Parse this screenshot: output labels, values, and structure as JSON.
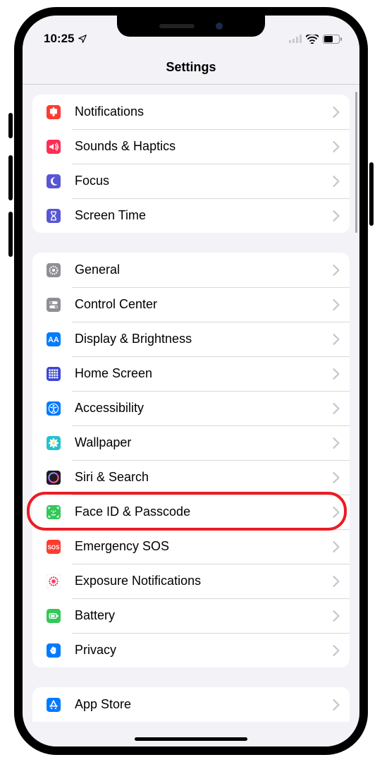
{
  "status": {
    "time": "10:25"
  },
  "header": {
    "title": "Settings"
  },
  "groups": [
    {
      "id": "g1",
      "items": [
        {
          "id": "notifications",
          "label": "Notifications",
          "icon": "bell-icon",
          "color": "#ff3b30"
        },
        {
          "id": "sounds-haptics",
          "label": "Sounds & Haptics",
          "icon": "speaker-icon",
          "color": "#ff2d55"
        },
        {
          "id": "focus",
          "label": "Focus",
          "icon": "moon-icon",
          "color": "#5856d6"
        },
        {
          "id": "screen-time",
          "label": "Screen Time",
          "icon": "hourglass-icon",
          "color": "#5856d6"
        }
      ]
    },
    {
      "id": "g2",
      "items": [
        {
          "id": "general",
          "label": "General",
          "icon": "gear-icon",
          "color": "#8e8e93"
        },
        {
          "id": "control-center",
          "label": "Control Center",
          "icon": "switches-icon",
          "color": "#8e8e93"
        },
        {
          "id": "display-brightness",
          "label": "Display & Brightness",
          "icon": "aa-icon",
          "color": "#007aff"
        },
        {
          "id": "home-screen",
          "label": "Home Screen",
          "icon": "grid-icon",
          "color": "#3b46d6"
        },
        {
          "id": "accessibility",
          "label": "Accessibility",
          "icon": "accessibility-icon",
          "color": "#007aff"
        },
        {
          "id": "wallpaper",
          "label": "Wallpaper",
          "icon": "flower-icon",
          "color": "#26c1cf"
        },
        {
          "id": "siri-search",
          "label": "Siri & Search",
          "icon": "siri-icon",
          "color": "#1c1c1e"
        },
        {
          "id": "face-id-passcode",
          "label": "Face ID & Passcode",
          "icon": "faceid-icon",
          "color": "#34c759",
          "highlighted": true
        },
        {
          "id": "emergency-sos",
          "label": "Emergency SOS",
          "icon": "sos-icon",
          "color": "#ff3b30"
        },
        {
          "id": "exposure-notifications",
          "label": "Exposure Notifications",
          "icon": "exposure-icon",
          "color": "#ffffff"
        },
        {
          "id": "battery",
          "label": "Battery",
          "icon": "battery-icon",
          "color": "#34c759"
        },
        {
          "id": "privacy",
          "label": "Privacy",
          "icon": "hand-icon",
          "color": "#007aff"
        }
      ]
    },
    {
      "id": "g3",
      "items": [
        {
          "id": "app-store",
          "label": "App Store",
          "icon": "appstore-icon",
          "color": "#007aff"
        }
      ]
    }
  ]
}
